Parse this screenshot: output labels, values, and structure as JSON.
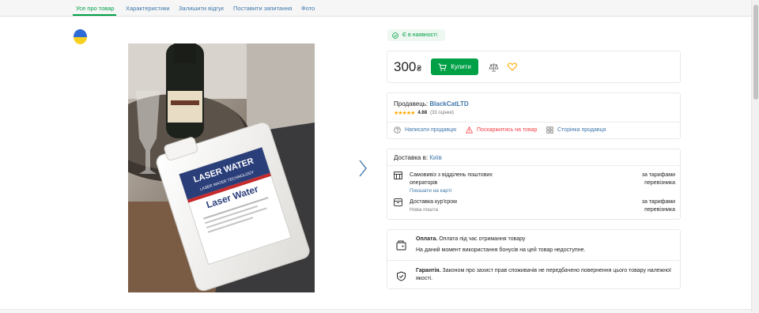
{
  "tabs": [
    {
      "label": "Усе про товар",
      "active": true
    },
    {
      "label": "Характеристики",
      "active": false
    },
    {
      "label": "Залишити відгук",
      "active": false
    },
    {
      "label": "Поставити запитання",
      "active": false
    },
    {
      "label": "Фото",
      "active": false
    }
  ],
  "photo": {
    "brand": "LASER WATER",
    "tagline": "LASER WATER TECHNOLOGY",
    "product_name": "Laser Water"
  },
  "status": {
    "label": "Є в наявності",
    "icon": "check-circle-icon"
  },
  "price": {
    "value": "300",
    "currency": "₴"
  },
  "buy_button": {
    "label": "Купити",
    "icon": "cart-icon"
  },
  "seller": {
    "prefix": "Продавець:",
    "name": "BlackCatLTD",
    "stars": "★★★★★",
    "rating": "4.68",
    "reviews": "(33 оцінки)",
    "links": [
      {
        "label": "Написати продавцю",
        "icon": "question-circle-icon"
      },
      {
        "label": "Поскаржитись на товар",
        "icon": "warning-icon"
      },
      {
        "label": "Сторінка продавця",
        "icon": "grid-icon"
      }
    ]
  },
  "delivery": {
    "prefix": "Доставка в:",
    "city": "Київ",
    "options": [
      {
        "title": "Самовивіз з відділень поштових операторів",
        "sub": "Показати на карті",
        "price": "за тарифами перевізника",
        "icon": "post-office-icon"
      },
      {
        "title": "Доставка кур'єром",
        "sub": "Нова пошта",
        "price": "за тарифами перевізника",
        "icon": "courier-box-icon"
      }
    ]
  },
  "payment": {
    "title": "Оплата.",
    "text": "Оплата під час отримання товару",
    "note": "На даний момент використання бонусів на цей товар недоступне.",
    "icon": "wallet-icon"
  },
  "warranty": {
    "title": "Гарантія.",
    "text": "Законом про захист прав споживачів не передбачено повернення цього товару належної якості.",
    "icon": "shield-icon"
  },
  "colors": {
    "accent": "#00a046",
    "link": "#3e77aa",
    "warn": "#f84147",
    "star": "#ffa900"
  }
}
